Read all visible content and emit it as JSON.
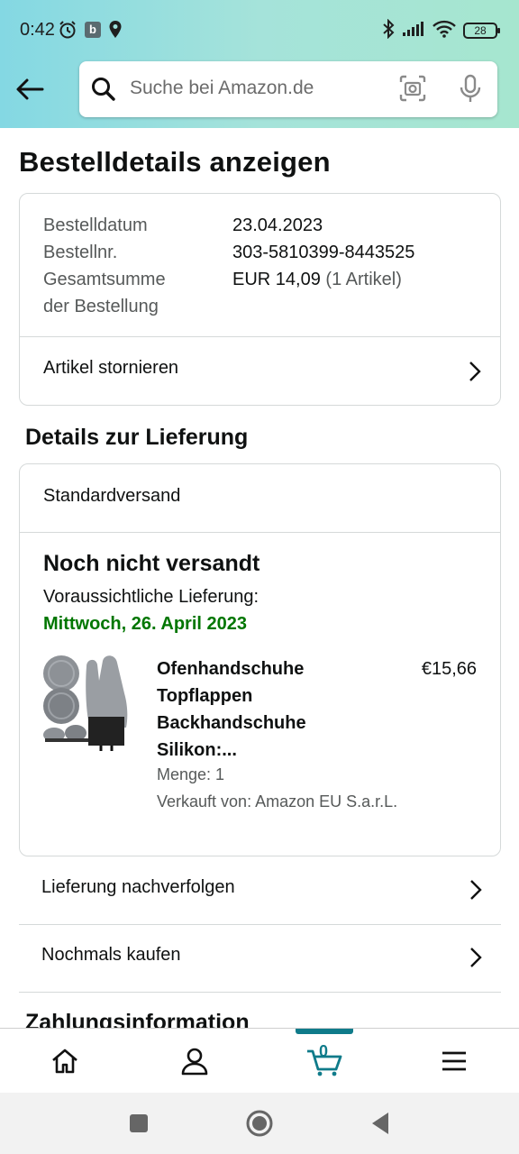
{
  "status_bar": {
    "time": "0:42",
    "badge_letter": "b",
    "battery": "28"
  },
  "header": {
    "search_placeholder": "Suche bei Amazon.de"
  },
  "page_title": "Bestelldetails anzeigen",
  "order_summary": {
    "date_label": "Bestelldatum",
    "date_value": "23.04.2023",
    "number_label": "Bestellnr.",
    "number_value": "303-5810399-8443525",
    "total_label_line1": "Gesamtsumme",
    "total_label_line2": "der Bestellung",
    "total_value": "EUR 14,09",
    "total_items": "(1 Artikel)",
    "cancel_link": "Artikel stornieren"
  },
  "delivery": {
    "heading": "Details zur Lieferung",
    "shipping_method": "Standardversand",
    "status": "Noch nicht versandt",
    "eta_label": "Voraussichtliche Lieferung:",
    "eta_date": "Mittwoch, 26. April 2023",
    "product": {
      "name_line1": "Ofenhandschuhe",
      "name_line2": "Topflappen",
      "name_line3": "Backhandschuhe",
      "name_line4": "Silikon:...",
      "price": "€15,66",
      "quantity": "Menge: 1",
      "seller": "Verkauft von: Amazon EU S.a.r.L."
    }
  },
  "actions": {
    "track": "Lieferung nachverfolgen",
    "buy_again": "Nochmals kaufen"
  },
  "next_section_peek": "Zahlungsinformation",
  "bottom_nav": {
    "cart_count": "0"
  },
  "colors": {
    "header_gradient_start": "#84d8e3",
    "header_gradient_end": "#a6e6cf",
    "eta_green": "#007600",
    "cart_accent": "#0f7b8a"
  }
}
